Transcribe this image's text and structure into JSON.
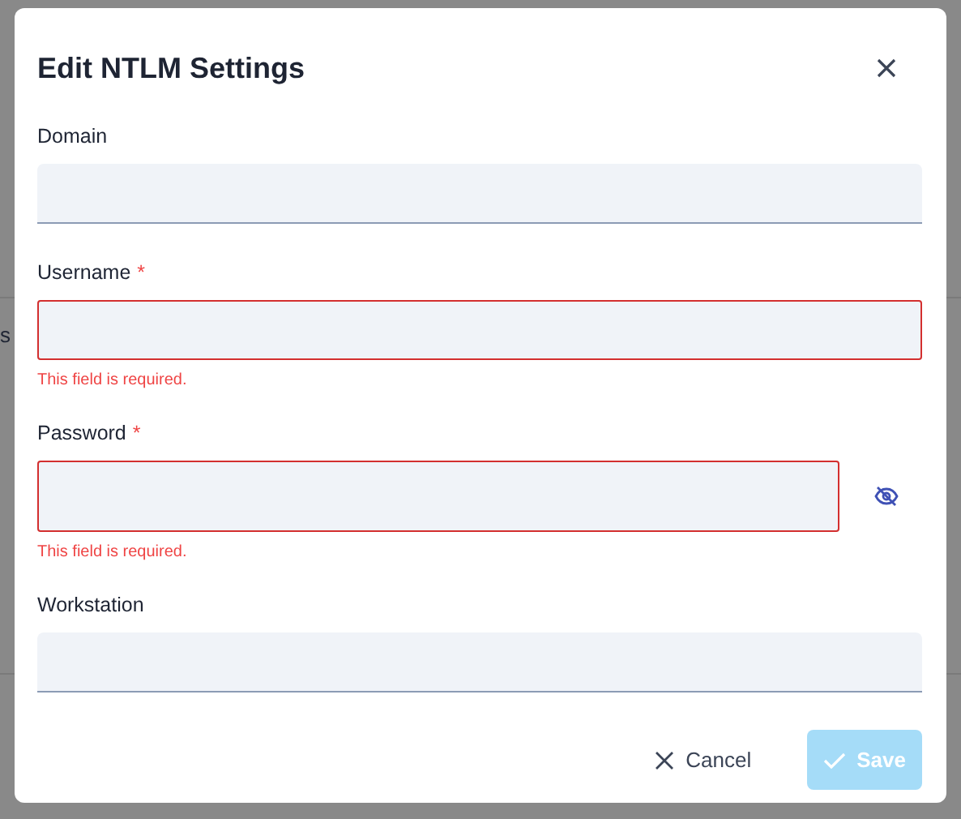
{
  "background": {
    "text": "s"
  },
  "dialog": {
    "title": "Edit NTLM Settings",
    "fields": [
      {
        "kind": "text",
        "label": "Domain"
      },
      {
        "kind": "text",
        "label": "Username",
        "required_mark": "*",
        "error": "This field is required."
      },
      {
        "kind": "password",
        "label": "Password",
        "required_mark": "*",
        "error": "This field is required."
      },
      {
        "kind": "text",
        "label": "Workstation"
      }
    ],
    "buttons": [
      {
        "kind": "cancel",
        "label": "Cancel",
        "disabled": false
      },
      {
        "kind": "save",
        "label": "Save",
        "disabled": true
      }
    ]
  }
}
